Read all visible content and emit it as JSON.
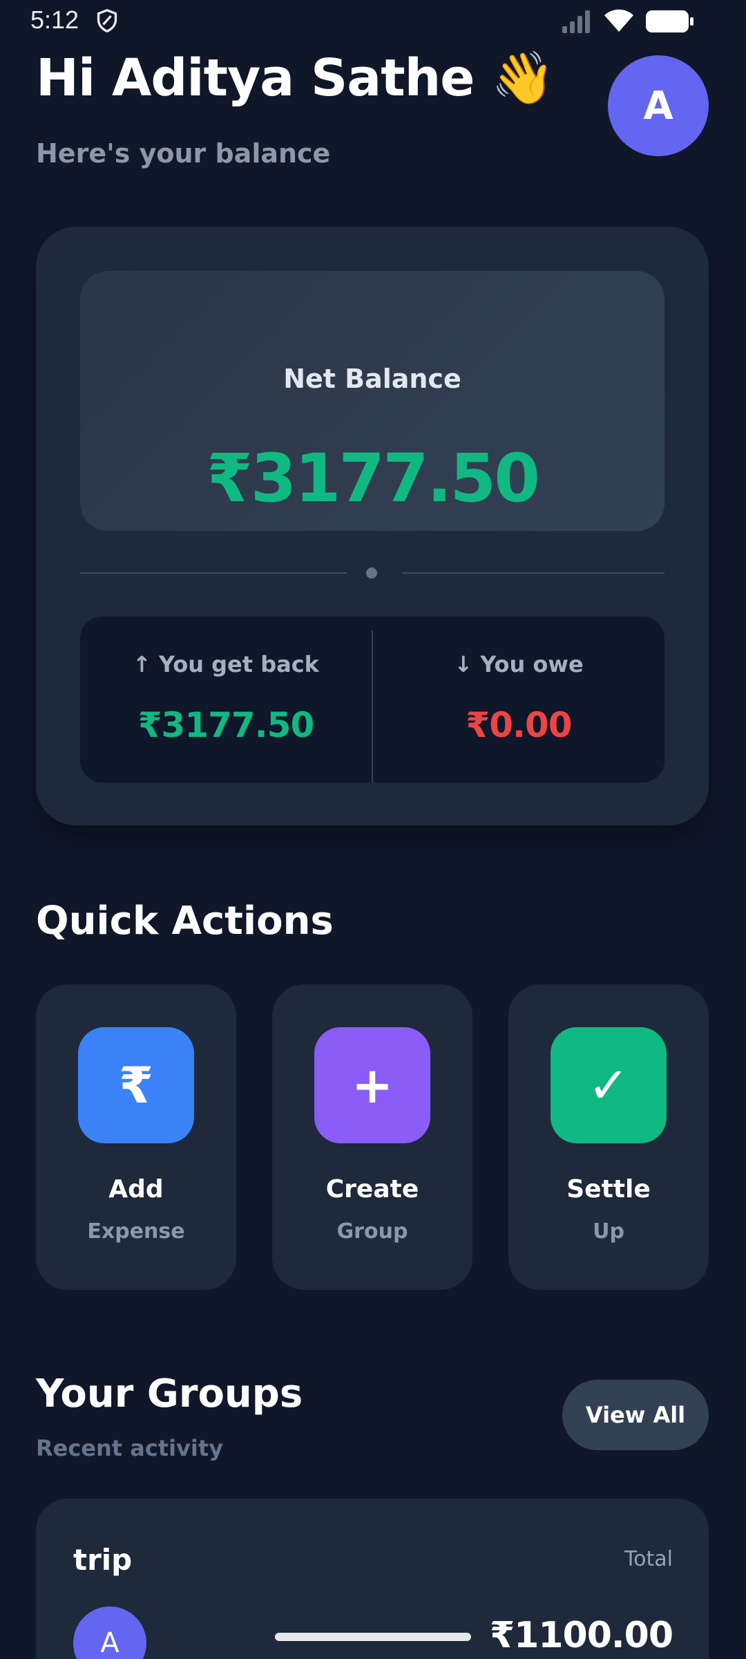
{
  "status_bar": {
    "time": "5:12"
  },
  "header": {
    "greeting": "Hi Aditya Sathe 👋",
    "subtitle": "Here's your balance",
    "avatar_initial": "A"
  },
  "balance": {
    "net_label": "Net Balance",
    "net_amount": "₹3177.50",
    "get_back_label": "↑ You get back",
    "get_back_amount": "₹3177.50",
    "owe_label": "↓ You owe",
    "owe_amount": "₹0.00"
  },
  "quick_actions": {
    "title": "Quick Actions",
    "items": [
      {
        "icon": "₹",
        "icon_name": "rupee-icon",
        "label": "Add",
        "sub": "Expense",
        "color": "#3b82f6"
      },
      {
        "icon": "+",
        "icon_name": "plus-icon",
        "label": "Create",
        "sub": "Group",
        "color": "#8b5cf6"
      },
      {
        "icon": "✓",
        "icon_name": "check-icon",
        "label": "Settle",
        "sub": "Up",
        "color": "#10b981"
      }
    ]
  },
  "groups": {
    "title": "Your Groups",
    "subtitle": "Recent activity",
    "view_all_label": "View All",
    "items": [
      {
        "name": "trip",
        "total_label": "Total",
        "avatar_initial": "A",
        "total": "₹1100.00"
      }
    ]
  },
  "colors": {
    "background": "#101729",
    "card": "#1e293b",
    "accent_positive": "#10b981",
    "accent_negative": "#ef4444",
    "avatar": "#6366f1"
  }
}
